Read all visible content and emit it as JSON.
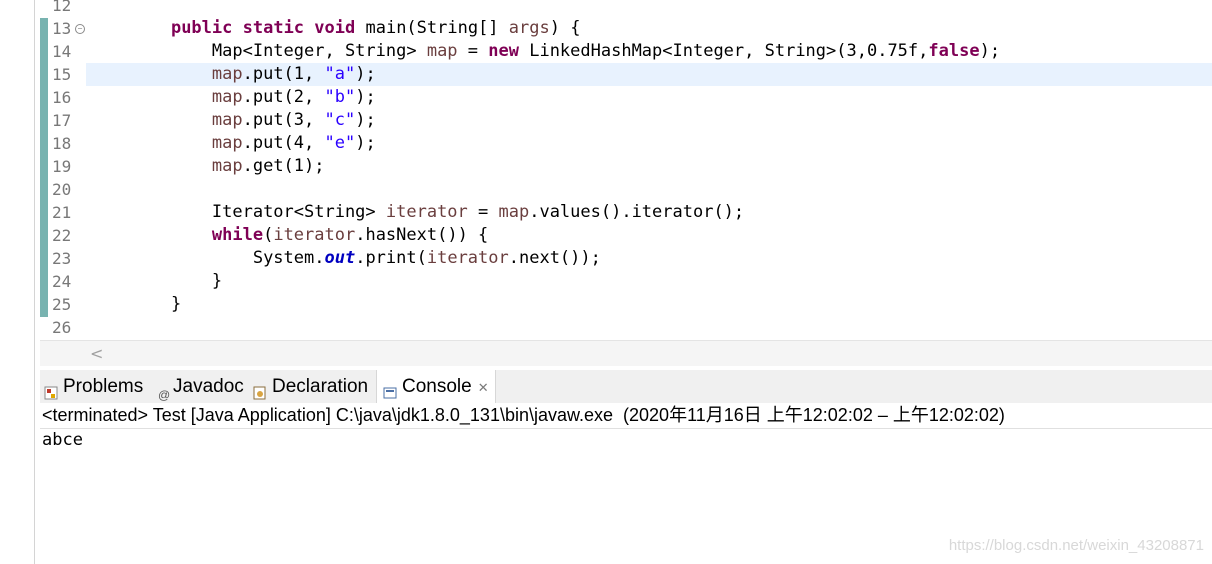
{
  "editor": {
    "lines": [
      {
        "num": "12",
        "html": ""
      },
      {
        "num": "13",
        "fold": true,
        "parts": [
          [
            "kw",
            "public"
          ],
          [
            "t",
            " "
          ],
          [
            "kw",
            "static"
          ],
          [
            "t",
            " "
          ],
          [
            "kw",
            "void"
          ],
          [
            "t",
            " main(String[] "
          ],
          [
            "var",
            "args"
          ],
          [
            "t",
            ") {"
          ]
        ],
        "indent": "    "
      },
      {
        "num": "14",
        "indent": "        ",
        "parts": [
          [
            "t",
            "Map<Integer, String> "
          ],
          [
            "var",
            "map"
          ],
          [
            "t",
            " = "
          ],
          [
            "kw",
            "new"
          ],
          [
            "t",
            " LinkedHashMap<Integer, String>(3,0.75f,"
          ],
          [
            "kw",
            "false"
          ],
          [
            "t",
            ");"
          ]
        ]
      },
      {
        "num": "15",
        "indent": "        ",
        "current": true,
        "parts": [
          [
            "var",
            "map"
          ],
          [
            "t",
            ".put(1, "
          ],
          [
            "str",
            "\"a\""
          ],
          [
            "t",
            ");"
          ]
        ]
      },
      {
        "num": "16",
        "indent": "        ",
        "parts": [
          [
            "var",
            "map"
          ],
          [
            "t",
            ".put(2, "
          ],
          [
            "str",
            "\"b\""
          ],
          [
            "t",
            ");"
          ]
        ]
      },
      {
        "num": "17",
        "indent": "        ",
        "parts": [
          [
            "var",
            "map"
          ],
          [
            "t",
            ".put(3, "
          ],
          [
            "str",
            "\"c\""
          ],
          [
            "t",
            ");"
          ]
        ]
      },
      {
        "num": "18",
        "indent": "        ",
        "parts": [
          [
            "var",
            "map"
          ],
          [
            "t",
            ".put(4, "
          ],
          [
            "str",
            "\"e\""
          ],
          [
            "t",
            ");"
          ]
        ]
      },
      {
        "num": "19",
        "indent": "        ",
        "parts": [
          [
            "var",
            "map"
          ],
          [
            "t",
            ".get(1);"
          ]
        ]
      },
      {
        "num": "20",
        "indent": "",
        "parts": []
      },
      {
        "num": "21",
        "indent": "        ",
        "parts": [
          [
            "t",
            "Iterator<String> "
          ],
          [
            "var",
            "iterator"
          ],
          [
            "t",
            " = "
          ],
          [
            "var",
            "map"
          ],
          [
            "t",
            ".values().iterator();"
          ]
        ]
      },
      {
        "num": "22",
        "indent": "        ",
        "parts": [
          [
            "kw",
            "while"
          ],
          [
            "t",
            "("
          ],
          [
            "var",
            "iterator"
          ],
          [
            "t",
            ".hasNext()) {"
          ]
        ]
      },
      {
        "num": "23",
        "indent": "            ",
        "parts": [
          [
            "t",
            "System."
          ],
          [
            "fld",
            "out"
          ],
          [
            "t",
            ".print("
          ],
          [
            "var",
            "iterator"
          ],
          [
            "t",
            ".next());"
          ]
        ]
      },
      {
        "num": "24",
        "indent": "        ",
        "parts": [
          [
            "t",
            "}"
          ]
        ]
      },
      {
        "num": "25",
        "indent": "    ",
        "parts": [
          [
            "t",
            "}"
          ]
        ]
      },
      {
        "num": "26",
        "indent": "",
        "parts": []
      }
    ]
  },
  "tabs": [
    {
      "label": "Problems",
      "icon": "problems-icon",
      "color": "#c0392b"
    },
    {
      "label": "Javadoc",
      "icon": "javadoc-icon",
      "color": "#555555"
    },
    {
      "label": "Declaration",
      "icon": "declaration-icon",
      "color": "#8a6d3b"
    },
    {
      "label": "Console",
      "icon": "console-icon",
      "color": "#4a6fa5",
      "active": true
    }
  ],
  "console": {
    "header": "<terminated> Test [Java Application] C:\\java\\jdk1.8.0_131\\bin\\javaw.exe  (2020年11月16日 上午12:02:02 – 上午12:02:02)",
    "output": "abce"
  },
  "watermark": "https://blog.csdn.net/weixin_43208871",
  "colors": {
    "keyword": "#7f0055",
    "variable": "#6a3e3e",
    "string": "#2a00ff",
    "field": "#0000c0",
    "current_line": "#e8f2fe"
  }
}
